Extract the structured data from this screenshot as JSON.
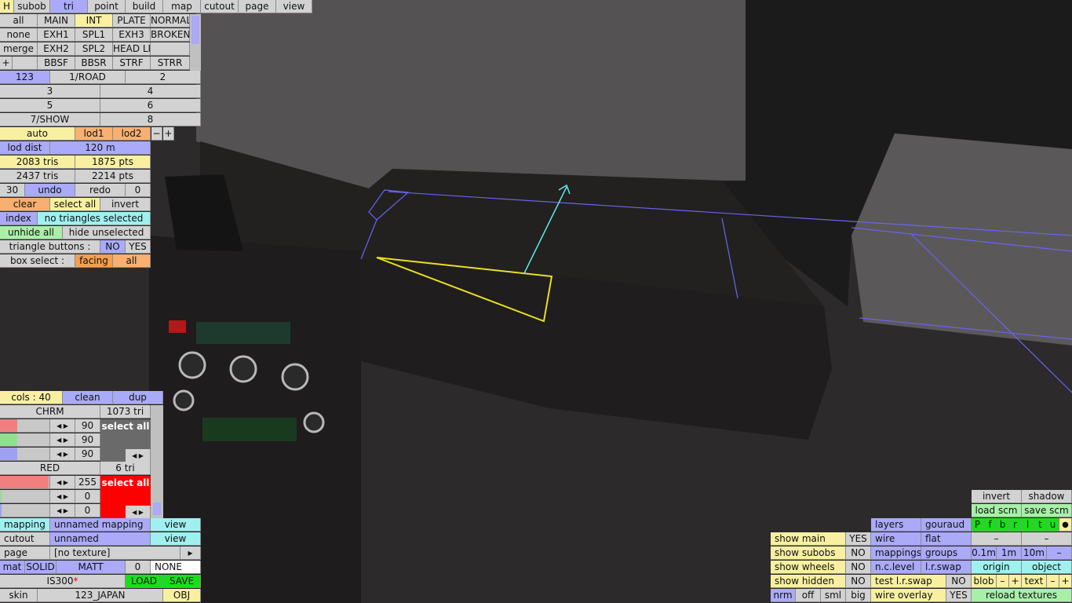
{
  "app": {
    "name": "ZModeler",
    "model_name": "IS300",
    "modified_marker": "*",
    "skin_value": "123_JAPAN"
  },
  "menu": {
    "h": "H",
    "tabs": [
      "subob",
      "tri",
      "point",
      "build",
      "map",
      "cutout",
      "page",
      "view"
    ],
    "active": "tri"
  },
  "subobjects": {
    "all": "all",
    "none": "none",
    "merge": "merge",
    "plus": "+",
    "grid": [
      [
        "MAIN",
        "INT",
        "PLATE",
        "NORMAL"
      ],
      [
        "EXH1",
        "SPL1",
        "EXH3",
        "BROKEN"
      ],
      [
        "EXH2",
        "SPL2",
        "HEAD LI",
        ""
      ],
      [
        "",
        "BBSF",
        "BBSR",
        "STRF",
        "STRR"
      ]
    ],
    "selected": "INT"
  },
  "layers": {
    "l123": "123",
    "l1": "1/ROAD",
    "l2": "2",
    "l3": "3",
    "l4": "4",
    "l5": "5",
    "l6": "6",
    "l7": "7/SHOW",
    "l8": "8"
  },
  "lod": {
    "auto": "auto",
    "lod1": "lod1",
    "lod2": "lod2",
    "minus": "−",
    "plus": "+",
    "dist_label": "lod dist",
    "dist_value": "120 m"
  },
  "stats": {
    "tris1": "2083 tris",
    "pts1": "1875 pts",
    "tris2": "2437 tris",
    "pts2": "2214 pts"
  },
  "undo": {
    "count": "30",
    "undo": "undo",
    "redo": "redo",
    "redo_count": "0"
  },
  "selection": {
    "clear": "clear",
    "select_all": "select all",
    "invert": "invert",
    "index_label": "index",
    "index_value": "no triangles selected",
    "unhide_all": "unhide all",
    "hide_unselected": "hide unselected",
    "tri_buttons_label": "triangle buttons :",
    "no": "NO",
    "yes": "YES",
    "box_select_label": "box select :",
    "facing": "facing",
    "box_all": "all"
  },
  "materials": {
    "cols_label": "cols : 40",
    "clean": "clean",
    "dup": "dup",
    "items": [
      {
        "name": "CHRM",
        "tri": "1073 tri",
        "values": [
          "90",
          "90",
          "90"
        ],
        "levels": {
          "r": 0.35,
          "g": 0.35,
          "b": 0.35
        },
        "swatch": "#6a6a6a"
      },
      {
        "name": "RED",
        "tri": "6 tri",
        "values": [
          "255",
          "0",
          "0"
        ],
        "levels": {
          "r": 1.0,
          "g": 0.0,
          "b": 0.0
        },
        "swatch": "#ff0000"
      }
    ],
    "select_all": "select all"
  },
  "mapping": {
    "mapping_label": "mapping",
    "mapping_value": "unnamed mapping",
    "view": "view",
    "cutout_label": "cutout",
    "cutout_value": "unnamed",
    "cutout_view": "view",
    "page_label": "page",
    "page_value": "[no texture]",
    "play": "▸"
  },
  "mat_row": {
    "mat": "mat",
    "solid": "SOLID",
    "matt": "MATT",
    "zero": "0",
    "none": "NONE"
  },
  "bottom": {
    "load": "LOAD",
    "save": "SAVE",
    "skin_label": "skin",
    "obj": "OBJ"
  },
  "display": {
    "show_main": "show main",
    "show_main_v": "YES",
    "show_subobs": "show subobs",
    "show_subobs_v": "NO",
    "show_wheels": "show wheels",
    "show_wheels_v": "NO",
    "show_hidden": "show hidden",
    "show_hidden_v": "NO",
    "nrm": "nrm",
    "off": "off",
    "sml": "sml",
    "big": "big"
  },
  "render": {
    "layers": "layers",
    "gouraud": "gouraud",
    "wire": "wire",
    "flat": "flat",
    "mappings": "mappings",
    "groups": "groups",
    "nclevel": "n.c.level",
    "lrswap": "l.r.swap",
    "test_lrswap": "test l.r.swap",
    "test_no": "NO",
    "wire_overlay": "wire overlay",
    "wire_yes": "YES"
  },
  "shadow": {
    "invert": "invert",
    "shadow": "shadow",
    "load_scm": "load scm",
    "save_scm": "save scm",
    "letters": [
      "P",
      "f",
      "b",
      "r",
      "l",
      "t",
      "u",
      "●"
    ],
    "dash": "–",
    "d01": "0.1m",
    "d1": "1m",
    "d10": "10m",
    "dminus": "–",
    "origin": "origin",
    "object": "object",
    "blob": "blob",
    "text": "text",
    "minus": "–",
    "plus": "+",
    "reload": "reload textures"
  },
  "colors": {
    "blue": "#aaaaf8",
    "yellow": "#f8f0a0",
    "orange": "#f8b070",
    "green": "#a8f0a8",
    "cyan": "#a0f0f0",
    "gray": "#d2d2d2",
    "bright_green": "#18e018",
    "red": "#ff0000"
  }
}
